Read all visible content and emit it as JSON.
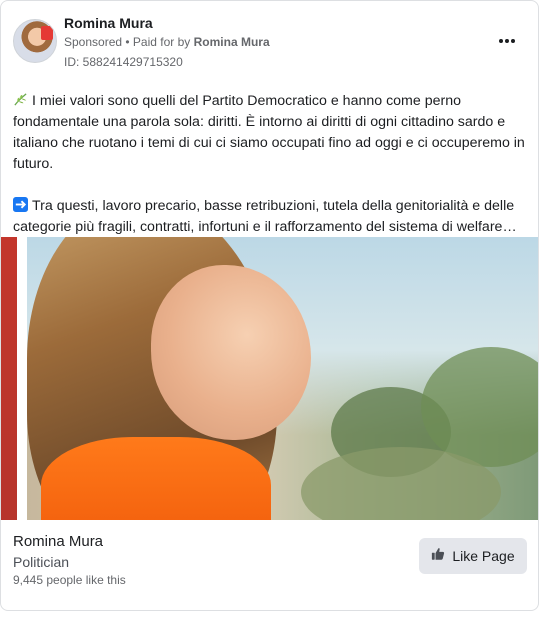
{
  "post": {
    "author": "Romina Mura",
    "sponsored": "Sponsored",
    "paid_for_prefix": "• Paid for by",
    "paid_for_name": "Romina Mura",
    "ad_id": "ID: 588241429715320",
    "paragraph_1": "I miei valori sono quelli del Partito Democratico e hanno come perno fondamentale una parola sola: diritti. È intorno ai diritti di ogni cittadino sardo e italiano che ruotano i temi di cui ci siamo occupati fino ad oggi e ci occuperemo in futuro.",
    "paragraph_2": "Tra questi, lavoro precario, basse retribuzioni, tutela della genitorialità e delle categorie più fragili, contratti, infortuni e il rafforzamento del sistema di welfare…"
  },
  "footer": {
    "page_name": "Romina Mura",
    "category": "Politician",
    "likes": "9,445 people like this",
    "like_button_label": "Like Page"
  },
  "icons": {
    "more": "more-options-icon",
    "leaf": "leaf-emoji-icon",
    "arrow": "right-arrow-emoji-icon",
    "like": "thumbs-up-icon"
  },
  "colors": {
    "text": "#1c1e21",
    "secondary": "#65676b",
    "button_bg": "#e4e6eb",
    "arrow_blue": "#1877f2"
  }
}
